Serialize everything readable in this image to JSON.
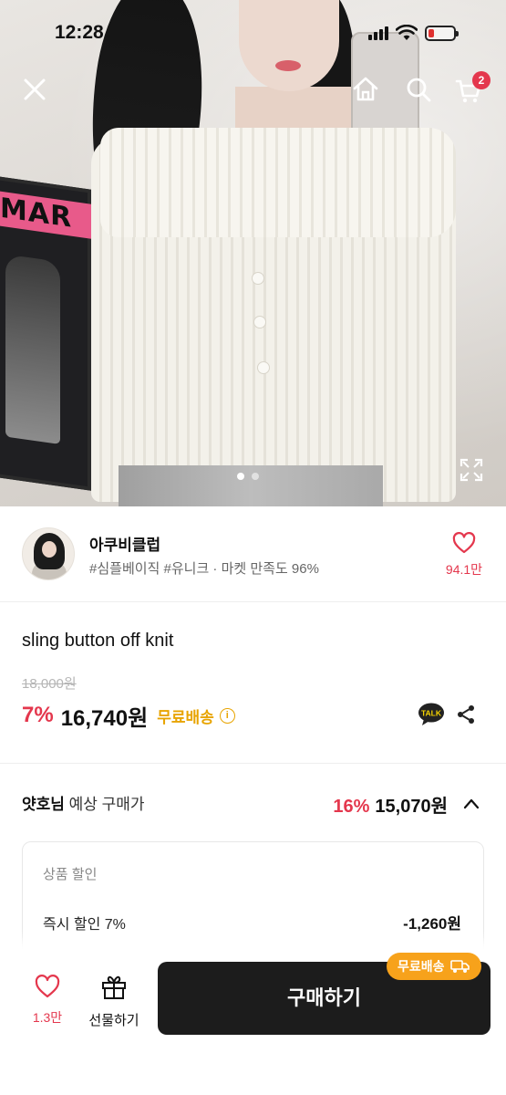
{
  "status_bar": {
    "time": "12:28"
  },
  "header": {
    "close_icon": "close-icon",
    "home_icon": "home-icon",
    "search_icon": "search-icon",
    "cart_icon": "cart-icon",
    "cart_count": "2"
  },
  "hero": {
    "poster_text": "MAR",
    "image_count": 2,
    "current_image": 1
  },
  "shop": {
    "name": "아쿠비클럽",
    "tags": "#심플베이직 #유니크 · 마켓 만족도 96%",
    "like_count": "94.1만"
  },
  "product": {
    "title": "sling button off knit",
    "original_price": "18,000원",
    "discount_rate": "7%",
    "price": "16,740원",
    "free_shipping": "무료배송",
    "info_icon": "i",
    "talk_label": "TALK"
  },
  "member_price": {
    "name": "얏호님",
    "label": " 예상 구매가",
    "discount_rate": "16%",
    "price": "15,070원"
  },
  "discount_box": {
    "title": "상품 할인",
    "line_label": "즉시 할인 7%",
    "line_value": "-1,260원"
  },
  "bottom_bar": {
    "like_count": "1.3만",
    "gift_label": "선물하기",
    "buy_label": "구매하기",
    "buy_badge": "무료배송"
  },
  "colors": {
    "accent_red": "#e4374d",
    "free_ship_yellow": "#e8a400",
    "badge_orange": "#f7a21b",
    "buy_button": "#1c1c1c"
  }
}
